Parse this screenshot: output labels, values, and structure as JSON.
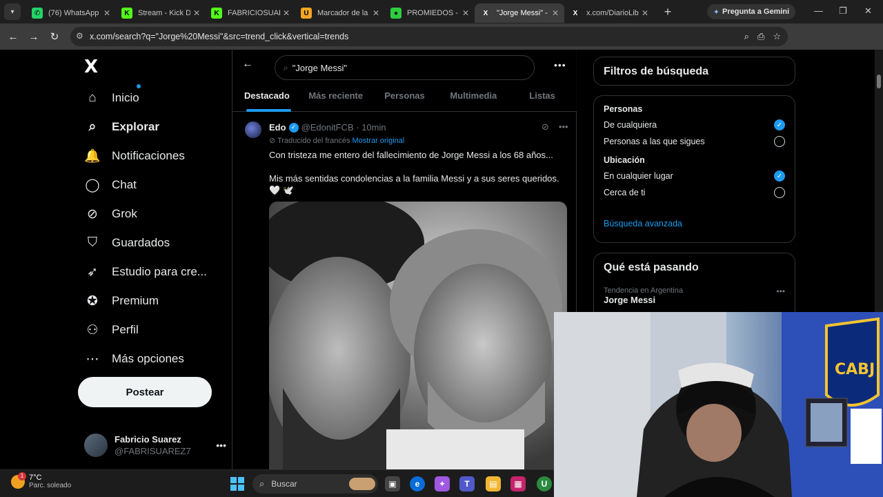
{
  "browser": {
    "tabs": [
      {
        "label": "(76) WhatsApp",
        "fav_color": "#25d366",
        "fav_glyph": "✆"
      },
      {
        "label": "Stream - Kick Da",
        "fav_color": "#53fc18",
        "fav_glyph": "K"
      },
      {
        "label": "FABRICIOSUARE",
        "fav_color": "#53fc18",
        "fav_glyph": "K"
      },
      {
        "label": "Marcador de la",
        "fav_color": "#f5a623",
        "fav_glyph": "U"
      },
      {
        "label": "PROMIEDOS - F",
        "fav_color": "#2ecc40",
        "fav_glyph": "●"
      },
      {
        "label": "\"Jorge Messi\" - ",
        "fav_color": "#ffffff",
        "fav_glyph": "X"
      },
      {
        "label": "x.com/DiarioLib",
        "fav_color": "#ffffff",
        "fav_glyph": "X"
      }
    ],
    "gemini_label": "Pregunta a Gemini",
    "url": "x.com/search?q=\"Jorge%20Messi\"&src=trend_click&vertical=trends"
  },
  "sidebar": {
    "logo": "X",
    "items": [
      {
        "label": "Inicio",
        "icon": "home-icon",
        "glyph": "⌂"
      },
      {
        "label": "Explorar",
        "icon": "search-icon",
        "glyph": "⌕"
      },
      {
        "label": "Notificaciones",
        "icon": "bell-icon",
        "glyph": "🔔"
      },
      {
        "label": "Chat",
        "icon": "chat-icon",
        "glyph": "◯"
      },
      {
        "label": "Grok",
        "icon": "grok-icon",
        "glyph": "⊘"
      },
      {
        "label": "Guardados",
        "icon": "bookmark-icon",
        "glyph": "⛉"
      },
      {
        "label": "Estudio para cre...",
        "icon": "rocket-icon",
        "glyph": "➶"
      },
      {
        "label": "Premium",
        "icon": "verified-icon",
        "glyph": "✪"
      },
      {
        "label": "Perfil",
        "icon": "person-icon",
        "glyph": "⚇"
      },
      {
        "label": "Más opciones",
        "icon": "more-circle-icon",
        "glyph": "⋯"
      }
    ],
    "post_button": "Postear",
    "profile": {
      "name": "Fabricio Suarez",
      "handle": "@FABRISUAREZ7"
    }
  },
  "main": {
    "search_value": "\"Jorge Messi\"",
    "tabs": [
      "Destacado",
      "Más reciente",
      "Personas",
      "Multimedia",
      "Listas"
    ],
    "tweet": {
      "name": "Edo",
      "handle": "@EdonitFCB",
      "time": "10min",
      "translated": "Traducido del francés",
      "show_original": "Mostrar original",
      "line1": "Con tristeza me entero del fallecimiento de Jorge Messi a los 68 años...",
      "line2": "Mis más sentidas condolencias a la familia Messi y a sus seres queridos. 🤍 🕊️"
    }
  },
  "right": {
    "filters_title": "Filtros de búsqueda",
    "people_label": "Personas",
    "people_options": [
      {
        "label": "De cualquiera",
        "checked": true
      },
      {
        "label": "Personas a las que sigues",
        "checked": false
      }
    ],
    "location_label": "Ubicación",
    "location_options": [
      {
        "label": "En cualquier lugar",
        "checked": true
      },
      {
        "label": "Cerca de ti",
        "checked": false
      }
    ],
    "advanced": "Búsqueda avanzada",
    "whats_happening": "Qué está pasando",
    "trend": {
      "category": "Tendencia en Argentina",
      "name": "Jorge Messi"
    }
  },
  "taskbar": {
    "weather_temp": "7°C",
    "weather_desc": "Parc. soleado",
    "weather_badge": "1",
    "search_placeholder": "Buscar"
  }
}
